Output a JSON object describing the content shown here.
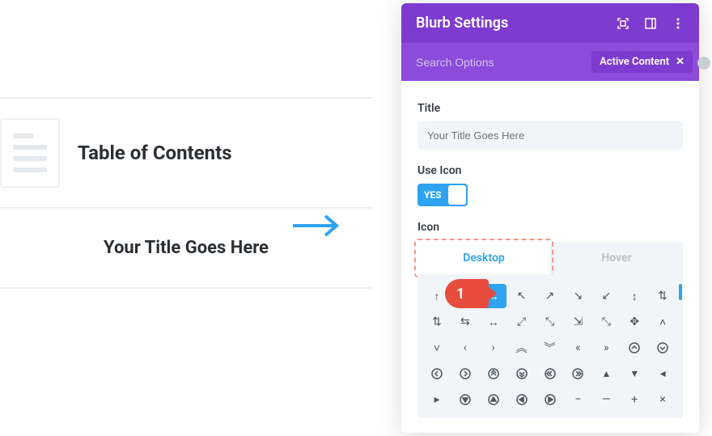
{
  "canvas": {
    "toc_heading": "Table of Contents",
    "item_title": "Your Title Goes Here"
  },
  "panel": {
    "title": "Blurb Settings",
    "search_placeholder": "Search Options",
    "filter_chip": "Active Content",
    "fields": {
      "title_label": "Title",
      "title_value": "Your Title Goes Here",
      "use_icon_label": "Use Icon",
      "use_icon_value": "YES",
      "icon_label": "Icon"
    },
    "tabs": {
      "desktop": "Desktop",
      "hover": "Hover"
    }
  },
  "callout": {
    "num": "1"
  },
  "icons": [
    "arrow-up",
    "arrow-right",
    "arrow-ne-thin",
    "arrow-ne",
    "arrow-se",
    "arrow-sw",
    "arrow-updown",
    "swap-vert",
    "swap-horiz",
    "resize",
    "expand-ne",
    "expand-out",
    "expand-in",
    "expand-full",
    "move",
    "caret-up",
    "caret-down",
    "chevron-left",
    "chevron-right",
    "chev2-up",
    "chev2-down",
    "chev2-left",
    "chev2-right",
    "circ-up",
    "circ-down",
    "circ-left",
    "circ-right",
    "circ2-up",
    "circ2-down",
    "circ2-left",
    "circ2-right",
    "tri-up",
    "tri-down",
    "tri-left",
    "tri-right",
    "play-circ-down",
    "play-circ-up",
    "play-circ-left",
    "play-circ-right",
    "minus",
    "line",
    "plus",
    "close"
  ],
  "selected_icon": "arrow-right"
}
